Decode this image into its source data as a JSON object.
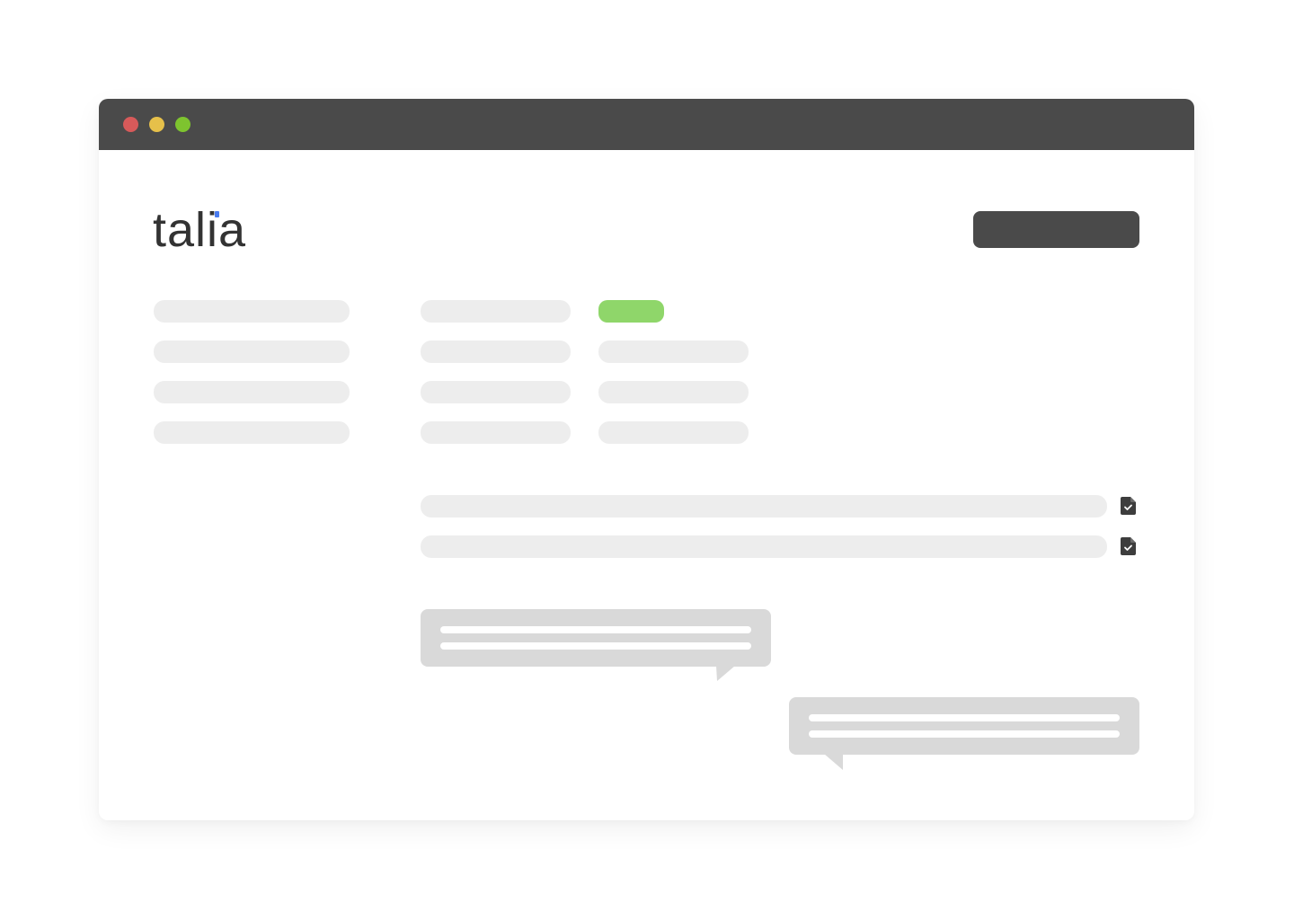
{
  "app": {
    "brand": "talia",
    "colors": {
      "titlebar": "#4a4a4a",
      "accent": "#4a7cf0",
      "status": "#8fd66a",
      "placeholder": "#ededed",
      "bubble": "#d9d9d9"
    }
  },
  "window_controls": [
    "close",
    "minimize",
    "zoom"
  ],
  "icons": {
    "document": "document-check-icon"
  }
}
